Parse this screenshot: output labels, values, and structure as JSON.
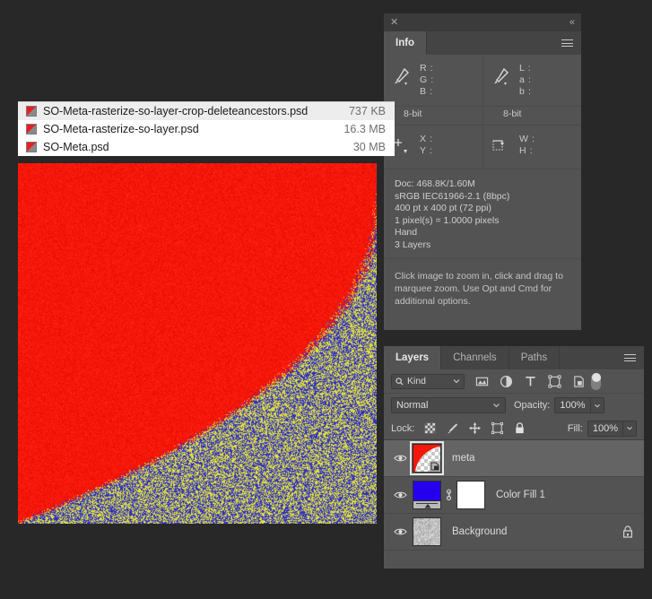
{
  "app": {
    "background_color": "#282828",
    "canvas": {
      "red_color": "#F51709",
      "noise_blue": "#3030C8",
      "noise_yellow": "#E0E03A",
      "noise_red": "#F51709"
    }
  },
  "file_list": {
    "rows": [
      {
        "name": "SO-Meta-rasterize-so-layer-crop-deleteancestors.psd",
        "size": "737 KB",
        "icon": "psd-file-icon",
        "highlighted": true
      },
      {
        "name": "SO-Meta-rasterize-so-layer.psd",
        "size": "16.3 MB",
        "icon": "psd-file-icon",
        "highlighted": false
      },
      {
        "name": "SO-Meta.psd",
        "size": "30 MB",
        "icon": "psd-file-icon",
        "highlighted": false
      }
    ]
  },
  "info_panel": {
    "titlebar": {
      "close_icon": "close-icon",
      "collapse_icon": "collapse-icon",
      "close_glyph": "✕",
      "collapse_glyph": "«"
    },
    "tabs": [
      {
        "label": "Info",
        "active": true
      }
    ],
    "menu_icon": "panel-menu-icon",
    "readouts": {
      "left": {
        "icon": "eyedropper-icon",
        "labels": [
          "R :",
          "G :",
          "B :"
        ],
        "depth": "8-bit"
      },
      "right": {
        "icon": "eyedropper-icon",
        "labels": [
          "L :",
          "a :",
          "b :"
        ],
        "depth": "8-bit"
      },
      "position": {
        "icon": "crosshair-icon",
        "labels": [
          "X :",
          "Y :"
        ]
      },
      "size": {
        "icon": "selection-size-icon",
        "labels": [
          "W :",
          "H :"
        ]
      }
    },
    "doc_info": [
      "Doc: 468.8K/1.60M",
      "sRGB IEC61966-2.1 (8bpc)",
      "400 pt x 400 pt (72 ppi)",
      "1 pixel(s) = 1.0000 pixels",
      "Hand",
      "3 Layers"
    ],
    "hint": "Click image to zoom in, click and drag to marquee zoom.  Use Opt and Cmd for additional options."
  },
  "layers_panel": {
    "tabs": [
      {
        "label": "Layers",
        "active": true
      },
      {
        "label": "Channels",
        "active": false
      },
      {
        "label": "Paths",
        "active": false
      }
    ],
    "menu_icon": "panel-menu-icon",
    "filter": {
      "search_icon": "search-icon",
      "kind_label": "Kind",
      "chevron_icon": "chevron-down-icon",
      "icons": [
        "filter-pixel-icon",
        "filter-adjustment-icon",
        "filter-type-icon",
        "filter-shape-icon",
        "filter-smart-object-icon"
      ],
      "toggle_icon": "filter-enable-toggle"
    },
    "blend": {
      "mode": "Normal",
      "mode_chevron_icon": "chevron-down-icon",
      "opacity_label": "Opacity:",
      "opacity_value": "100%",
      "opacity_stepper_icon": "chevron-down-icon"
    },
    "lock": {
      "label": "Lock:",
      "icons": [
        "lock-transparent-pixels-icon",
        "lock-image-pixels-icon",
        "lock-position-icon",
        "lock-artboard-nesting-icon",
        "lock-all-icon"
      ],
      "fill_label": "Fill:",
      "fill_value": "100%",
      "fill_stepper_icon": "chevron-down-icon"
    },
    "layers": [
      {
        "name": "meta",
        "visible": true,
        "visibility_icon": "eye-icon",
        "selected": true,
        "thumb": "smart-object-red-curve",
        "locked": false
      },
      {
        "name": "Color Fill 1",
        "visible": true,
        "visibility_icon": "eye-icon",
        "selected": false,
        "thumb": "solid-blue-fill",
        "link_icon": "link-icon",
        "mask_thumb": "white-mask",
        "locked": false
      },
      {
        "name": "Background",
        "visible": true,
        "visibility_icon": "eye-icon",
        "selected": false,
        "thumb": "gray-noise",
        "locked": true,
        "lock_icon": "lock-icon"
      }
    ]
  }
}
